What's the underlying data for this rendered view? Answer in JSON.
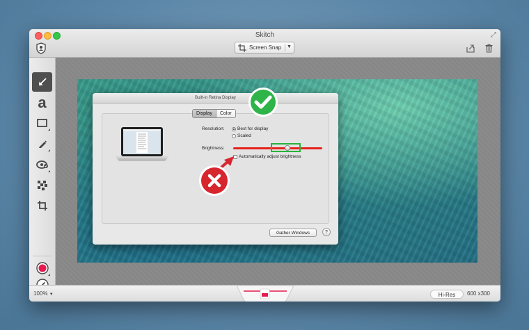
{
  "window": {
    "title": "Skitch"
  },
  "toolbar": {
    "screen_snap_label": "Screen Snap",
    "tools": [
      {
        "name": "arrow-tool",
        "icon": "arrow-icon",
        "active": true
      },
      {
        "name": "text-tool",
        "icon": "text-a-icon",
        "glyph": "a"
      },
      {
        "name": "shape-tool",
        "icon": "rectangle-icon"
      },
      {
        "name": "marker-tool",
        "icon": "marker-icon"
      },
      {
        "name": "highlight-tool",
        "icon": "stamp-icon"
      },
      {
        "name": "pixelate-tool",
        "icon": "pixelate-icon"
      },
      {
        "name": "crop-tool",
        "icon": "crop-icon"
      },
      {
        "name": "color-picker",
        "icon": "color-dot-icon",
        "color": "#e8194f"
      },
      {
        "name": "line-width-picker",
        "icon": "pen-size-icon"
      }
    ]
  },
  "snapshot": {
    "dialog_title": "Built-in Retina Display",
    "tabs": [
      {
        "label": "Display",
        "selected": true
      },
      {
        "label": "Color",
        "selected": false
      }
    ],
    "resolution_label": "Resolution:",
    "resolution_options": [
      {
        "label": "Best for display",
        "selected": true
      },
      {
        "label": "Scaled",
        "selected": false
      }
    ],
    "brightness_label": "Brightness:",
    "brightness_level": 0.55,
    "auto_brightness_label": "Automatically adjust brightness",
    "gather_windows_label": "Gather Windows",
    "help_label": "?"
  },
  "status": {
    "zoom": "100%",
    "hires": "Hi-Res",
    "dimensions": "600 x300"
  },
  "colors": {
    "accent_red": "#e6211b",
    "check_green": "#27b33a",
    "badge_red": "#d8262e"
  }
}
